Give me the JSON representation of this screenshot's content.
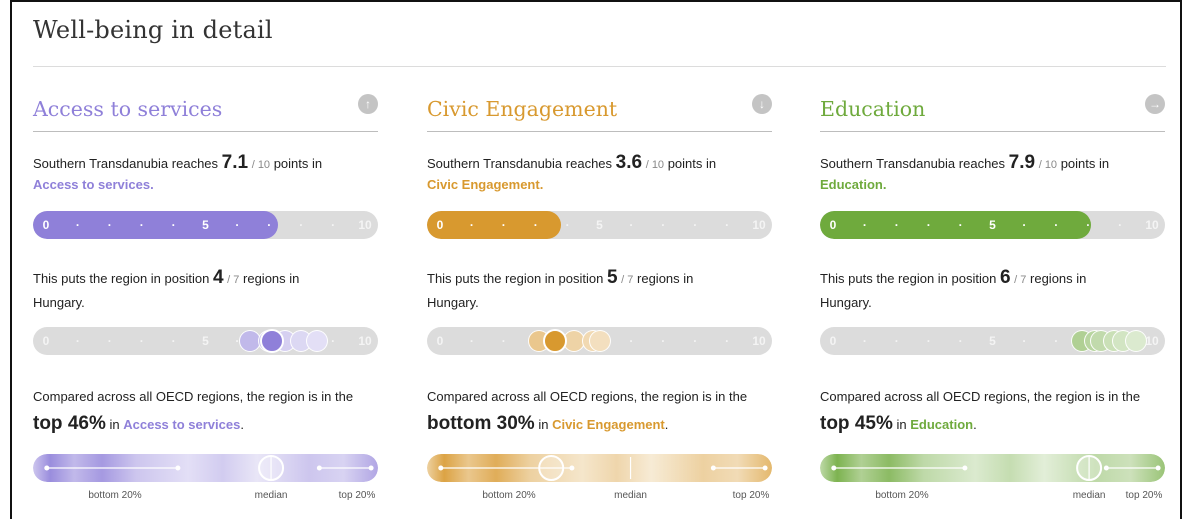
{
  "page": {
    "title": "Well-being in detail"
  },
  "columns": [
    {
      "key": "access",
      "title": "Access to services",
      "color": "#8f80d9",
      "nav_icon": "arrow-up-circle-icon",
      "nav_glyph": "↑",
      "region": "Southern Transdanubia",
      "reaches_text": "reaches",
      "score": "7.1",
      "score_value": 7.1,
      "score_out_of": "/ 10",
      "points_in": "points in",
      "topic_label": "Access to services.",
      "rank_text": "This puts the region in position",
      "rank": "4",
      "rank_out_of": "/ 7",
      "rank_suffix": "regions in",
      "country": "Hungary.",
      "peer_values": [
        6.4,
        7.0,
        7.1,
        7.5,
        8.0,
        8.5
      ],
      "oecd_text": "Compared across all OECD regions, the region is in the",
      "oecd_rank": "top 46%",
      "oecd_in": "in",
      "oecd_topic": "Access to services",
      "oecd_end": ".",
      "position_percentile": 0.69,
      "median_percentile": 0.69,
      "label_bottom": "bottom 20%",
      "label_median": "median",
      "label_top": "top 20%"
    },
    {
      "key": "civic",
      "title": "Civic Engagement",
      "color": "#d8992f",
      "nav_icon": "arrow-down-circle-icon",
      "nav_glyph": "↓",
      "region": "Southern Transdanubia",
      "reaches_text": "reaches",
      "score": "3.6",
      "score_value": 3.6,
      "score_out_of": "/ 10",
      "points_in": "points in",
      "topic_label": "Civic Engagement.",
      "rank_text": "This puts the region in position",
      "rank": "5",
      "rank_out_of": "/ 7",
      "rank_suffix": "regions in",
      "country": "Hungary.",
      "peer_values": [
        3.1,
        3.6,
        4.2,
        4.8,
        5.0
      ],
      "oecd_text": "Compared across all OECD regions, the region is in the",
      "oecd_rank": "bottom 30%",
      "oecd_in": "in",
      "oecd_topic": "Civic Engagement",
      "oecd_end": ".",
      "position_percentile": 0.36,
      "median_percentile": 0.59,
      "label_bottom": "bottom 20%",
      "label_median": "median",
      "label_top": "top 20%"
    },
    {
      "key": "education",
      "title": "Education",
      "color": "#6faa3d",
      "nav_icon": "arrow-right-circle-icon",
      "nav_glyph": "→",
      "region": "Southern Transdanubia",
      "reaches_text": "reaches",
      "score": "7.9",
      "score_value": 7.9,
      "score_out_of": "/ 10",
      "points_in": "points in",
      "topic_label": "Education.",
      "rank_text": "This puts the region in position",
      "rank": "6",
      "rank_out_of": "/ 7",
      "rank_suffix": "regions in",
      "country": "Hungary.",
      "peer_values": [
        7.8,
        8.2,
        8.4,
        8.8,
        9.1,
        9.5
      ],
      "oecd_text": "Compared across all OECD regions, the region is in the",
      "oecd_rank": "top 45%",
      "oecd_in": "in",
      "oecd_topic": "Education",
      "oecd_end": ".",
      "position_percentile": 0.78,
      "median_percentile": 0.78,
      "label_bottom": "bottom 20%",
      "label_median": "median",
      "label_top": "top 20%"
    }
  ],
  "scale_ticks": [
    "0",
    "·",
    "·",
    "·",
    "·",
    "5",
    "·",
    "·",
    "·",
    "·",
    "10"
  ]
}
